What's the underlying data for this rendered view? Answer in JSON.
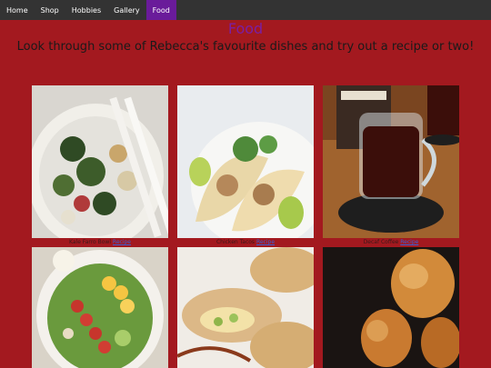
{
  "nav": {
    "items": [
      {
        "label": "Home"
      },
      {
        "label": "Shop"
      },
      {
        "label": "Hobbies"
      },
      {
        "label": "Gallery"
      },
      {
        "label": "Food"
      }
    ]
  },
  "header": {
    "title": "Food",
    "subtitle": "Look through some of Rebecca's favourite dishes and try out a recipe or two!"
  },
  "dishes": [
    {
      "name": "Kale Farro Bowl",
      "link": "Recipe"
    },
    {
      "name": "Chicken Tacos",
      "link": "Recipe"
    },
    {
      "name": "Decaf Coffee",
      "link": "Recipe"
    },
    {
      "name": "",
      "link": ""
    },
    {
      "name": "",
      "link": ""
    },
    {
      "name": "",
      "link": ""
    }
  ],
  "colors": {
    "background": "#a3191f",
    "nav_bg": "#333333",
    "nav_active": "#6a1b9a",
    "title": "#7b1fa2",
    "link": "#3a5fd6"
  }
}
